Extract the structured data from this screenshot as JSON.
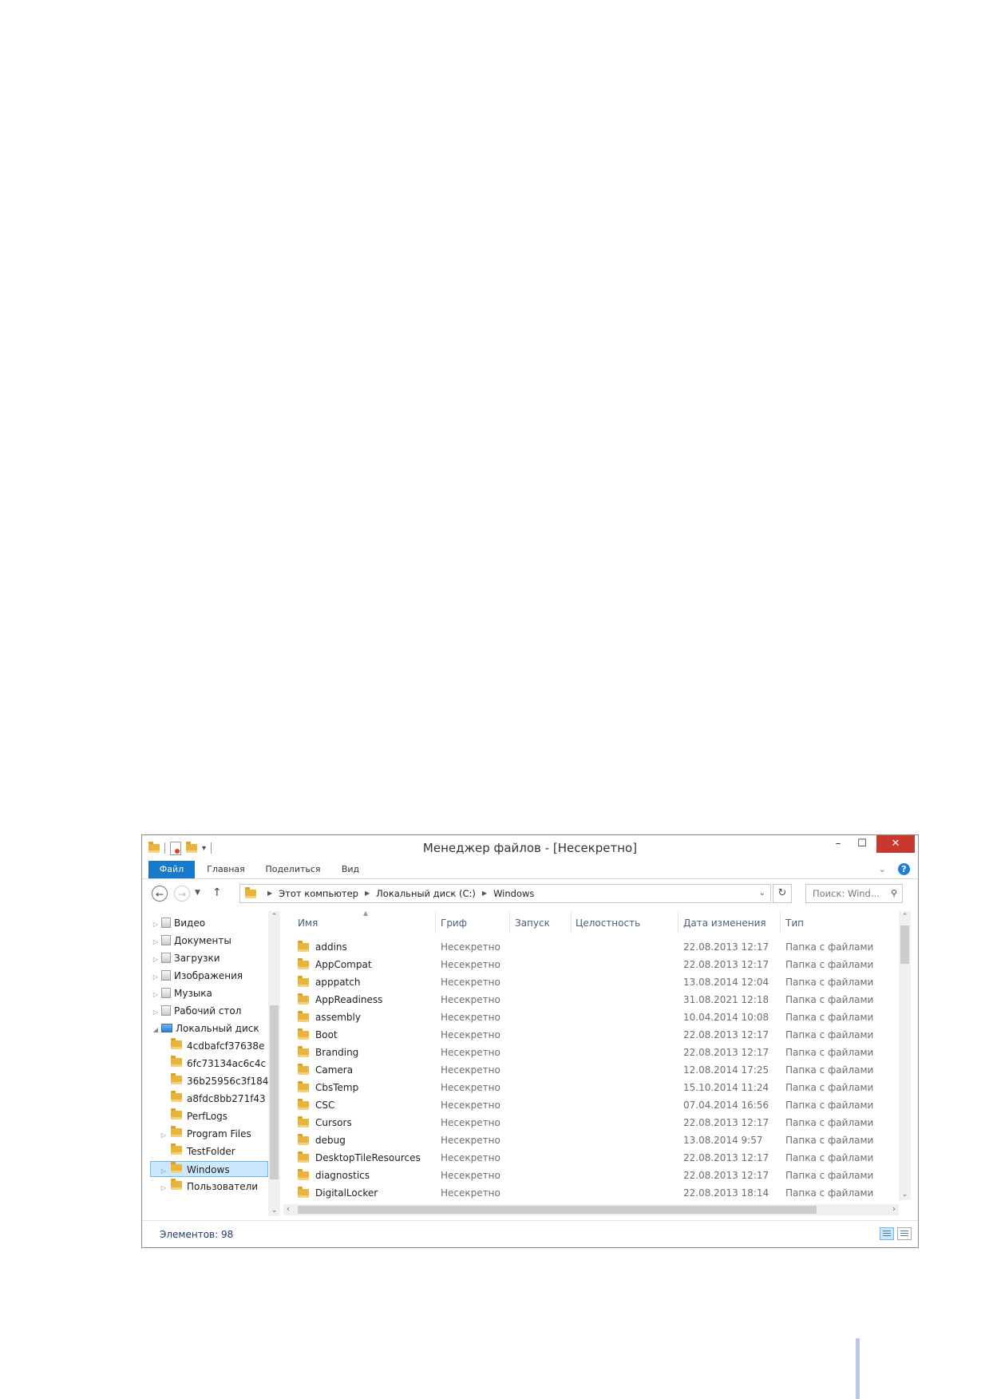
{
  "window": {
    "title": "Менеджер файлов - [Несекретно]",
    "close_glyph": "✕",
    "minimize_glyph": "–",
    "maximize_glyph": "☐"
  },
  "ribbon": {
    "tabs": [
      {
        "label": "Файл",
        "active": true
      },
      {
        "label": "Главная"
      },
      {
        "label": "Поделиться"
      },
      {
        "label": "Вид"
      }
    ],
    "help_glyph": "?"
  },
  "nav": {
    "breadcrumb": [
      "Этот компьютер",
      "Локальный диск (C:)",
      "Windows"
    ],
    "search_placeholder": "Поиск: Wind..."
  },
  "tree": {
    "items": [
      {
        "label": "Видео",
        "icon": "library-video-icon"
      },
      {
        "label": "Документы",
        "icon": "library-documents-icon"
      },
      {
        "label": "Загрузки",
        "icon": "downloads-icon"
      },
      {
        "label": "Изображения",
        "icon": "library-pictures-icon"
      },
      {
        "label": "Музыка",
        "icon": "library-music-icon"
      },
      {
        "label": "Рабочий стол",
        "icon": "desktop-icon"
      },
      {
        "label": "Локальный диск",
        "icon": "drive-icon",
        "expanded": true
      },
      {
        "label": "4cdbafcf37638e",
        "icon": "folder-icon"
      },
      {
        "label": "6fc73134ac6c4c",
        "icon": "folder-icon"
      },
      {
        "label": "36b25956c3f184",
        "icon": "folder-icon"
      },
      {
        "label": "a8fdc8bb271f43",
        "icon": "folder-icon"
      },
      {
        "label": "PerfLogs",
        "icon": "folder-icon"
      },
      {
        "label": "Program Files",
        "icon": "folder-icon"
      },
      {
        "label": "TestFolder",
        "icon": "folder-icon"
      },
      {
        "label": "Windows",
        "icon": "folder-icon",
        "selected": true
      },
      {
        "label": "Пользователи",
        "icon": "folder-icon"
      }
    ]
  },
  "list": {
    "columns": [
      "Имя",
      "Гриф",
      "Запуск",
      "Целостность",
      "Дата изменения",
      "Тип"
    ],
    "rows": [
      {
        "name": "addins",
        "grif": "Несекретно",
        "date": "22.08.2013 12:17",
        "type": "Папка с файлами"
      },
      {
        "name": "AppCompat",
        "grif": "Несекретно",
        "date": "22.08.2013 12:17",
        "type": "Папка с файлами"
      },
      {
        "name": "apppatch",
        "grif": "Несекретно",
        "date": "13.08.2014 12:04",
        "type": "Папка с файлами"
      },
      {
        "name": "AppReadiness",
        "grif": "Несекретно",
        "date": "31.08.2021 12:18",
        "type": "Папка с файлами"
      },
      {
        "name": "assembly",
        "grif": "Несекретно",
        "date": "10.04.2014 10:08",
        "type": "Папка с файлами"
      },
      {
        "name": "Boot",
        "grif": "Несекретно",
        "date": "22.08.2013 12:17",
        "type": "Папка с файлами"
      },
      {
        "name": "Branding",
        "grif": "Несекретно",
        "date": "22.08.2013 12:17",
        "type": "Папка с файлами"
      },
      {
        "name": "Camera",
        "grif": "Несекретно",
        "date": "12.08.2014 17:25",
        "type": "Папка с файлами"
      },
      {
        "name": "CbsTemp",
        "grif": "Несекретно",
        "date": "15.10.2014 11:24",
        "type": "Папка с файлами"
      },
      {
        "name": "CSC",
        "grif": "Несекретно",
        "date": "07.04.2014 16:56",
        "type": "Папка с файлами"
      },
      {
        "name": "Cursors",
        "grif": "Несекретно",
        "date": "22.08.2013 12:17",
        "type": "Папка с файлами"
      },
      {
        "name": "debug",
        "grif": "Несекретно",
        "date": "13.08.2014 9:57",
        "type": "Папка с файлами"
      },
      {
        "name": "DesktopTileResources",
        "grif": "Несекретно",
        "date": "22.08.2013 12:17",
        "type": "Папка с файлами"
      },
      {
        "name": "diagnostics",
        "grif": "Несекретно",
        "date": "22.08.2013 12:17",
        "type": "Папка с файлами"
      },
      {
        "name": "DigitalLocker",
        "grif": "Несекретно",
        "date": "22.08.2013 18:14",
        "type": "Папка с файлами"
      }
    ]
  },
  "status": {
    "text": "Элементов: 98"
  }
}
